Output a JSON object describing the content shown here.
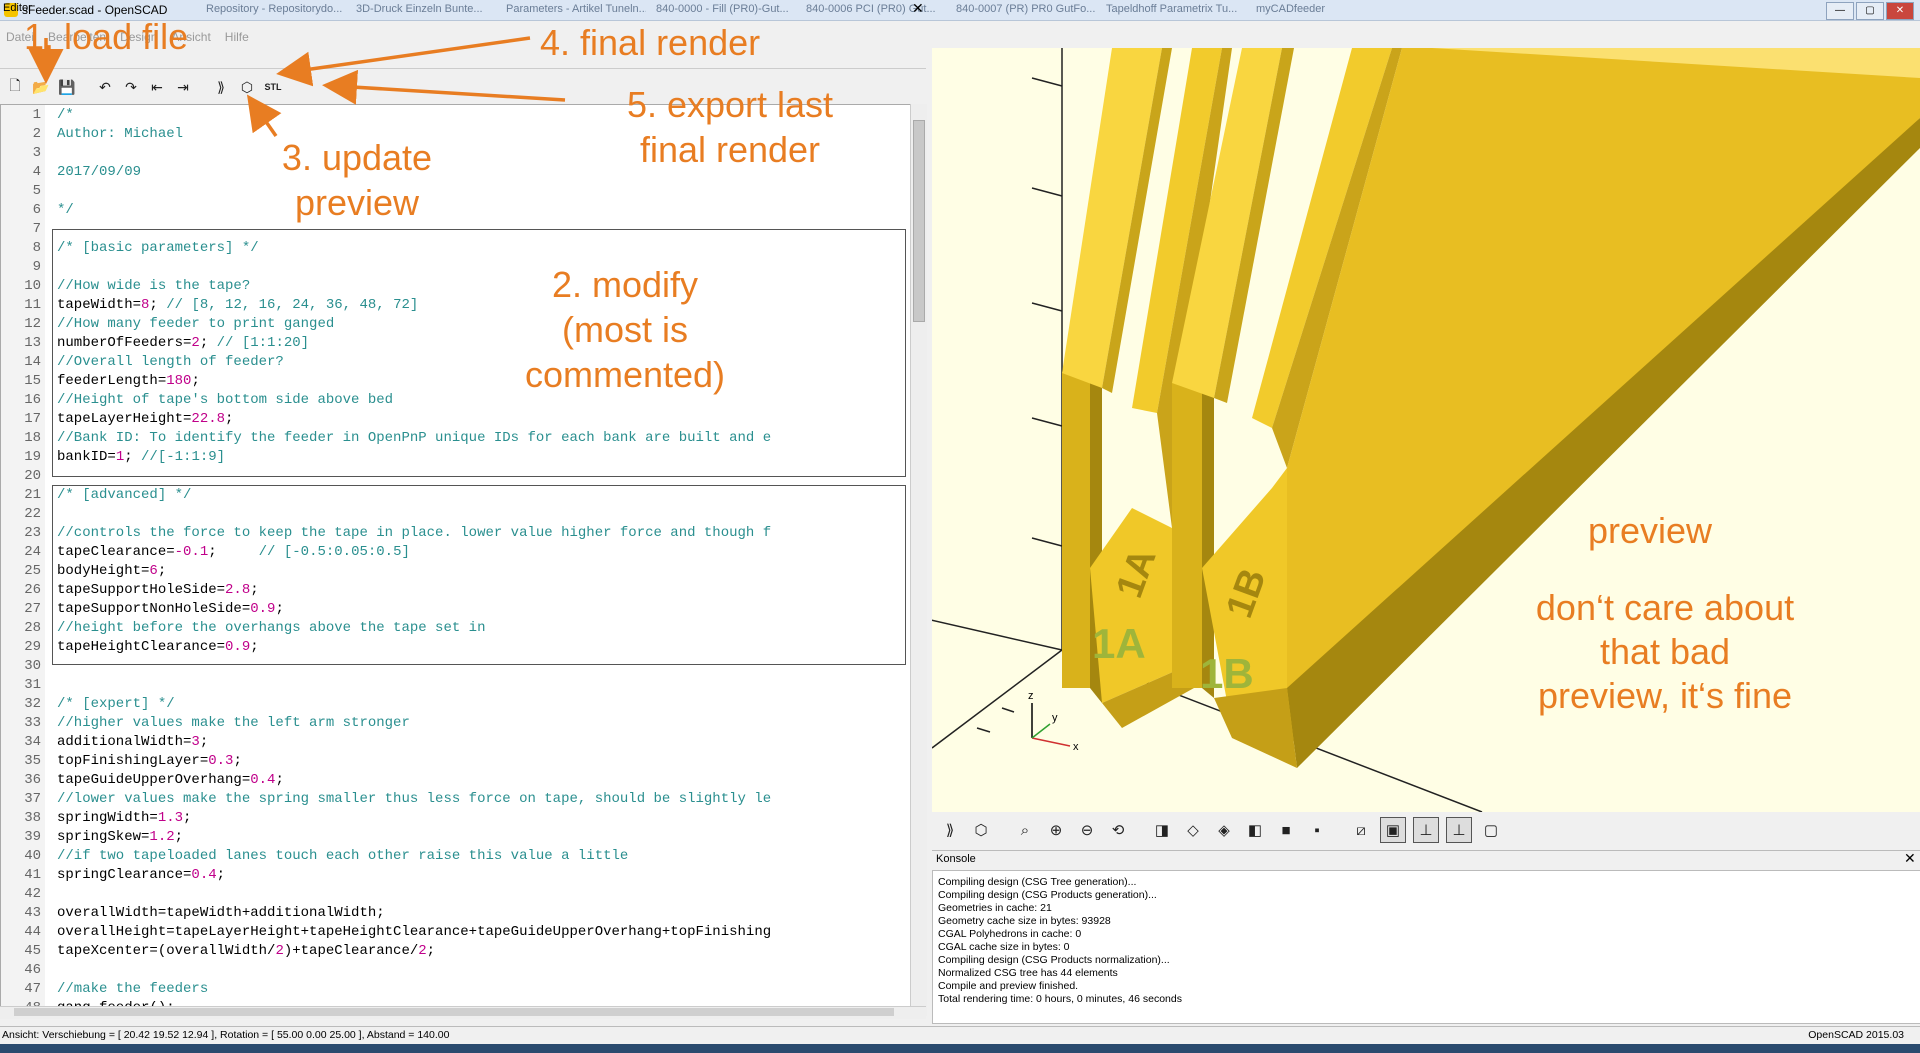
{
  "window": {
    "title": "sFeeder.scad - OpenSCAD",
    "bg_tabs": [
      "Repository - Repositorydo...",
      "3D-Druck Einzeln Bunte...",
      "Parameters - Artikel Tuneln...",
      "840-0000 - Fill (PR0)-Gut...",
      "840-0006 PCI (PR0) Gut...",
      "840-0007 (PR) PR0 GutFo...",
      "Tapeldhoff Parametrix Tu...",
      "myCADfeeder"
    ]
  },
  "menu": [
    "Datei",
    "Bearbeiten",
    "Design",
    "Ansicht",
    "Hilfe"
  ],
  "editor": {
    "title": "Editor",
    "close": "✕",
    "toolbar": [
      {
        "name": "new-file-icon",
        "glyph": "🗋"
      },
      {
        "name": "open-file-icon",
        "glyph": "📂"
      },
      {
        "name": "save-file-icon",
        "glyph": "💾"
      },
      {
        "name": "undo-icon",
        "glyph": "↶"
      },
      {
        "name": "redo-icon",
        "glyph": "↷"
      },
      {
        "name": "unindent-icon",
        "glyph": "⇤"
      },
      {
        "name": "indent-icon",
        "glyph": "⇥"
      },
      {
        "name": "preview-icon",
        "glyph": "⟫"
      },
      {
        "name": "render-icon",
        "glyph": "⬡"
      },
      {
        "name": "export-stl-icon",
        "glyph": "STL"
      }
    ],
    "lines": [
      "/*",
      "Author: Michael",
      "",
      "2017/09/09",
      "",
      "*/",
      "",
      "/* [basic parameters] */",
      "",
      "//How wide is the tape?",
      "tapeWidth=8; // [8, 12, 16, 24, 36, 48, 72]",
      "//How many feeder to print ganged",
      "numberOfFeeders=2; // [1:1:20]",
      "//Overall length of feeder?",
      "feederLength=180;",
      "//Height of tape's bottom side above bed",
      "tapeLayerHeight=22.8;",
      "//Bank ID: To identify the feeder in OpenPnP unique IDs for each bank are built and e",
      "bankID=1; //[-1:1:9]",
      "",
      "/* [advanced] */",
      "",
      "//controls the force to keep the tape in place. lower value higher force and though f",
      "tapeClearance=-0.1;     // [-0.5:0.05:0.5]",
      "bodyHeight=6;",
      "tapeSupportHoleSide=2.8;",
      "tapeSupportNonHoleSide=0.9;",
      "//height before the overhangs above the tape set in",
      "tapeHeightClearance=0.9;",
      "",
      "",
      "/* [expert] */",
      "//higher values make the left arm stronger",
      "additionalWidth=3;",
      "topFinishingLayer=0.3;",
      "tapeGuideUpperOverhang=0.4;",
      "//lower values make the spring smaller thus less force on tape, should be slightly le",
      "springWidth=1.3;",
      "springSkew=1.2;",
      "//if two tapeloaded lanes touch each other raise this value a little",
      "springClearance=0.4;",
      "",
      "overallWidth=tapeWidth+additionalWidth;",
      "overallHeight=tapeLayerHeight+tapeHeightClearance+tapeGuideUpperOverhang+topFinishing",
      "tapeXcenter=(overallWidth/2)+tapeClearance/2;",
      "",
      "//make the feeders",
      "gang_feeder();"
    ]
  },
  "viewport": {
    "labels": [
      "1A",
      "1B"
    ],
    "axis": [
      "z",
      "y",
      "x"
    ]
  },
  "viewtoolbar": [
    {
      "name": "preview-icon",
      "glyph": "⟫"
    },
    {
      "name": "render-icon",
      "glyph": "⬡"
    },
    {
      "name": "view-all-icon",
      "glyph": "⌕"
    },
    {
      "name": "zoom-in-icon",
      "glyph": "⊕"
    },
    {
      "name": "zoom-out-icon",
      "glyph": "⊖"
    },
    {
      "name": "reset-view-icon",
      "glyph": "⟲"
    },
    {
      "name": "view-right-icon",
      "glyph": "◨"
    },
    {
      "name": "view-top-icon",
      "glyph": "◇"
    },
    {
      "name": "view-bottom-icon",
      "glyph": "◈"
    },
    {
      "name": "view-left-icon",
      "glyph": "◧"
    },
    {
      "name": "view-front-icon",
      "glyph": "■"
    },
    {
      "name": "view-back-icon",
      "glyph": "▪"
    },
    {
      "name": "perspective-icon",
      "glyph": "⧄"
    },
    {
      "name": "orthogonal-icon",
      "glyph": "▣"
    },
    {
      "name": "axes-icon",
      "glyph": "⊥"
    },
    {
      "name": "scale-markers-icon",
      "glyph": "⊥"
    },
    {
      "name": "edges-icon",
      "glyph": "▢"
    }
  ],
  "konsole": {
    "title": "Konsole",
    "close": "✕",
    "lines": [
      "Compiling design (CSG Tree generation)...",
      "Compiling design (CSG Products generation)...",
      "Geometries in cache: 21",
      "Geometry cache size in bytes: 93928",
      "CGAL Polyhedrons in cache: 0",
      "CGAL cache size in bytes: 0",
      "Compiling design (CSG Products normalization)...",
      "Normalized CSG tree has 44 elements",
      "Compile and preview finished.",
      "Total rendering time: 0 hours, 0 minutes, 46 seconds"
    ]
  },
  "status": {
    "text": "Ansicht: Verschiebung = [ 20.42 19.52 12.94 ], Rotation = [ 55.00 0.00 25.00 ], Abstand = 140.00",
    "version": "OpenSCAD 2015.03"
  },
  "annotations": {
    "a1": "1. load file",
    "a2_l1": "2. modify",
    "a2_l2": "(most is",
    "a2_l3": "commented)",
    "a3_l1": "3. update",
    "a3_l2": "preview",
    "a4": "4. final render",
    "a5_l1": "5. export last",
    "a5_l2": "final render",
    "p_l1": "preview",
    "p_l2": "don‘t care about",
    "p_l3": "that bad",
    "p_l4": "preview, it‘s fine"
  },
  "colors": {
    "annotation": "#e87d22",
    "model_light": "#f9d640",
    "model_mid": "#d9b21b",
    "model_dark": "#a5870f",
    "viewport_bg": "#fffee5"
  }
}
